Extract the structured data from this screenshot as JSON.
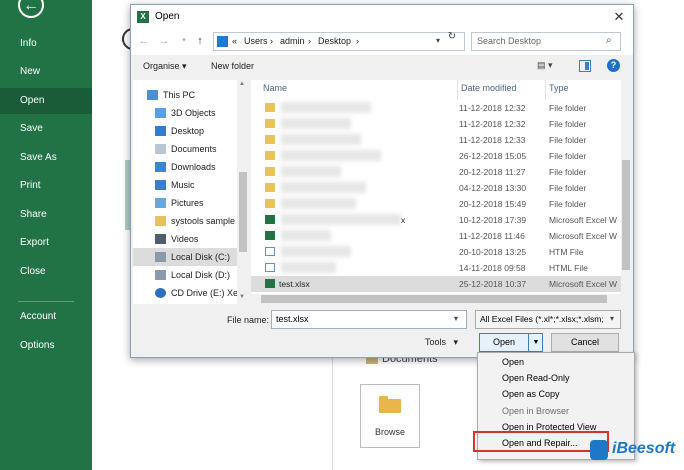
{
  "backstage": {
    "items": [
      "Info",
      "New",
      "Open",
      "Save",
      "Save As",
      "Print",
      "Share",
      "Export",
      "Close",
      "Account",
      "Options"
    ],
    "documents_label": "Documents",
    "browse_label": "Browse"
  },
  "dialog": {
    "title": "Open",
    "breadcrumbs": [
      "«",
      "Users",
      "›",
      "admin",
      "›",
      "Desktop",
      "›"
    ],
    "search_placeholder": "Search Desktop",
    "toolbar": {
      "organise": "Organise ▾",
      "new_folder": "New folder"
    },
    "nav_items": [
      "This PC",
      "3D Objects",
      "Desktop",
      "Documents",
      "Downloads",
      "Music",
      "Pictures",
      "systools sample",
      "Videos",
      "Local Disk (C:)",
      "Local Disk (D:)",
      "CD Drive (E:) Xer"
    ],
    "columns": {
      "name": "Name",
      "date": "Date modified",
      "type": "Type"
    },
    "files": [
      {
        "name": "",
        "date": "11-12-2018 12:32",
        "type": "File folder"
      },
      {
        "name": "",
        "date": "11-12-2018 12:32",
        "type": "File folder"
      },
      {
        "name": "",
        "date": "11-12-2018 12:33",
        "type": "File folder"
      },
      {
        "name": "",
        "date": "26-12-2018 15:05",
        "type": "File folder"
      },
      {
        "name": "",
        "date": "20-12-2018 11:27",
        "type": "File folder"
      },
      {
        "name": "",
        "date": "04-12-2018 13:30",
        "type": "File folder"
      },
      {
        "name": "",
        "date": "20-12-2018 15:49",
        "type": "File folder"
      },
      {
        "name": "x",
        "date": "10-12-2018 17:39",
        "type": "Microsoft Excel W"
      },
      {
        "name": "",
        "date": "11-12-2018 11:46",
        "type": "Microsoft Excel W"
      },
      {
        "name": "",
        "date": "20-10-2018 13:25",
        "type": "HTM File"
      },
      {
        "name": "",
        "date": "14-11-2018 09:58",
        "type": "HTML File"
      },
      {
        "name": "test.xlsx",
        "date": "25-12-2018 10:37",
        "type": "Microsoft Excel W"
      }
    ],
    "file_name_label": "File name:",
    "file_name_value": "test.xlsx",
    "filter_value": "All Excel Files (*.xl*;*.xlsx;*.xlsm;",
    "tools_label": "Tools",
    "open_label": "Open",
    "cancel_label": "Cancel"
  },
  "open_menu": {
    "items": [
      {
        "label": "Open",
        "enabled": true
      },
      {
        "label": "Open Read-Only",
        "enabled": true
      },
      {
        "label": "Open as Copy",
        "enabled": true
      },
      {
        "label": "Open in Browser",
        "enabled": false
      },
      {
        "label": "Open in Protected View",
        "enabled": true
      },
      {
        "label": "Open and Repair...",
        "enabled": true
      }
    ]
  },
  "watermark": "iBeesoft",
  "colors": {
    "excel_green": "#217346",
    "highlight_red": "#d9342b",
    "accent_blue": "#1e78c8"
  }
}
